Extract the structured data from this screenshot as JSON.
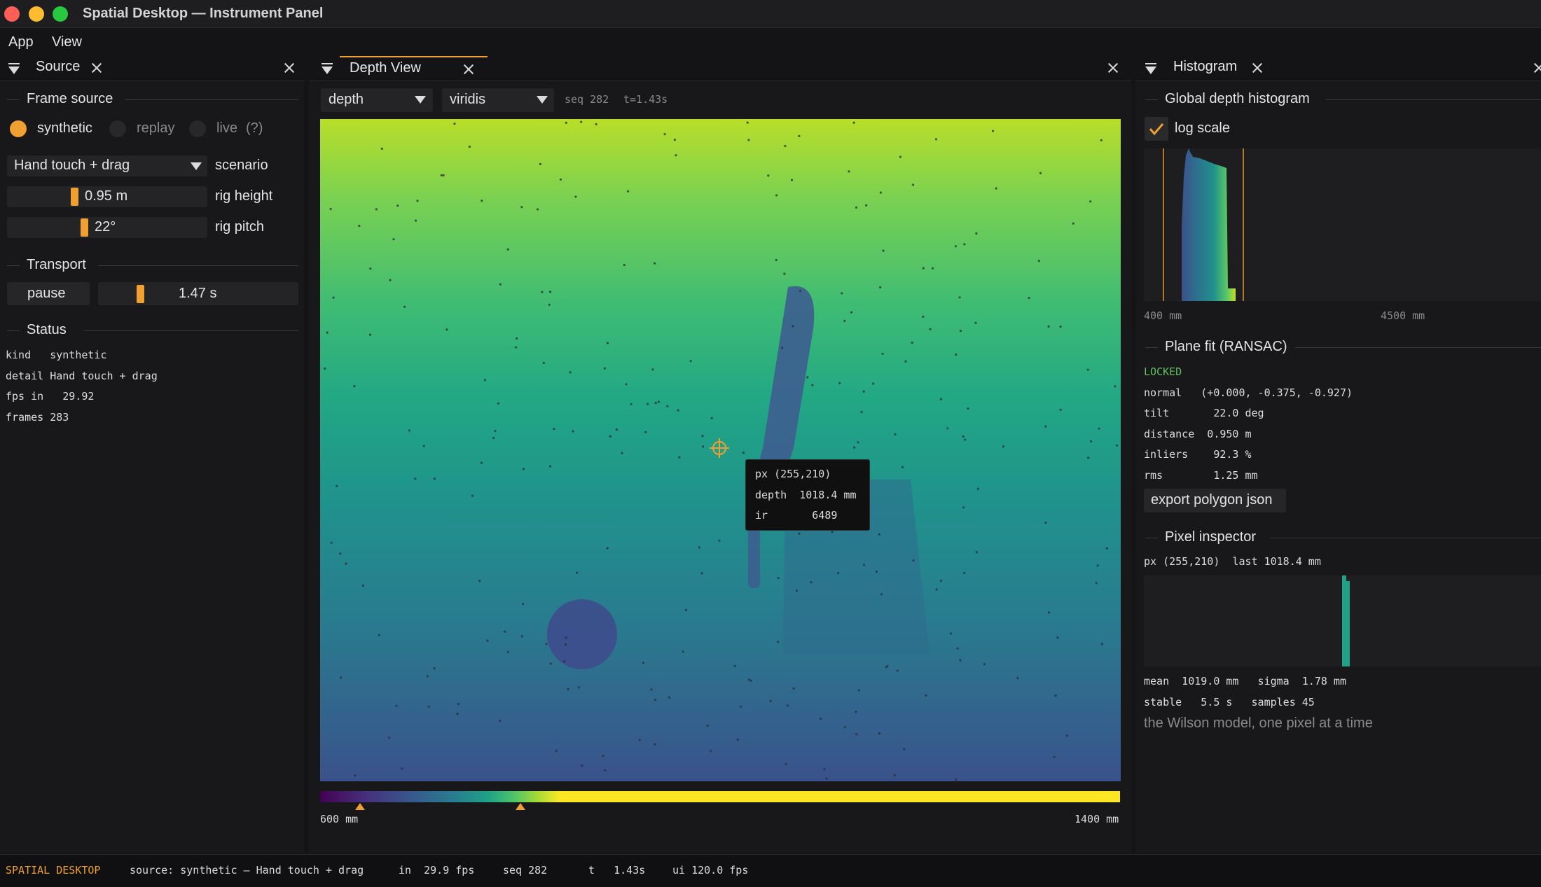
{
  "window": {
    "title": "Spatial Desktop — Instrument Panel"
  },
  "menu": [
    "App",
    "View"
  ],
  "source_panel": {
    "tab_label": "Source",
    "frame_source": {
      "heading": "Frame source",
      "options": [
        "synthetic",
        "replay",
        "live"
      ],
      "selected": "synthetic",
      "help": "(?)"
    },
    "scenario": {
      "value": "Hand touch + drag",
      "label": "scenario"
    },
    "rig_height": {
      "value": "0.95 m",
      "label": "rig height",
      "level": 0.33
    },
    "rig_pitch": {
      "value": "22°",
      "label": "rig pitch",
      "level": 0.38
    },
    "transport": {
      "heading": "Transport",
      "pause_label": "pause",
      "time": "1.47 s",
      "level": 0.2
    },
    "status": {
      "heading": "Status",
      "lines": [
        "kind   synthetic",
        "detail Hand touch + drag",
        "fps in   29.92",
        "frames 283"
      ]
    }
  },
  "depth_panel": {
    "tab_label": "Depth View",
    "mode": "depth",
    "colormap": "viridis",
    "seq": "seq 282",
    "time": "t=1.43s",
    "tooltip": {
      "px": "px (255,210)",
      "depth": "depth  1018.4 mm",
      "ir": "ir       6489"
    },
    "colorbar": {
      "min_label": "600 mm",
      "max_label": "1400 mm",
      "markers": [
        0.05,
        0.25
      ]
    }
  },
  "histogram_panel": {
    "tab_label": "Histogram",
    "global": {
      "heading": "Global depth histogram",
      "log_scale_label": "log scale",
      "log_scale_checked": true,
      "axis_min": "400 mm",
      "axis_max": "4500 mm"
    },
    "plane_fit": {
      "heading": "Plane fit (RANSAC)",
      "state": "LOCKED",
      "lines": [
        "normal   (+0.000, -0.375, -0.927)",
        "tilt       22.0 deg",
        "distance  0.950 m",
        "inliers    92.3 %",
        "rms        1.25 mm"
      ],
      "export_label": "export polygon json"
    },
    "pixel_inspector": {
      "heading": "Pixel inspector",
      "header_line": "px (255,210)  last 1018.4 mm",
      "stats_line_1": "mean  1019.0 mm   sigma  1.78 mm",
      "stats_line_2": "stable   5.5 s   samples 45",
      "caption": "the Wilson model, one pixel at a time"
    }
  },
  "status_bar": {
    "brand": "SPATIAL DESKTOP",
    "source": "source: synthetic — Hand touch + drag",
    "fps_in": "in  29.9 fps",
    "seq": "seq 282",
    "t": "t   1.43s",
    "ui_fps": "ui 120.0 fps"
  },
  "colors": {
    "accent": "#f0a030",
    "locked": "#5fbf5f",
    "tooltip_bg": "#101010"
  }
}
